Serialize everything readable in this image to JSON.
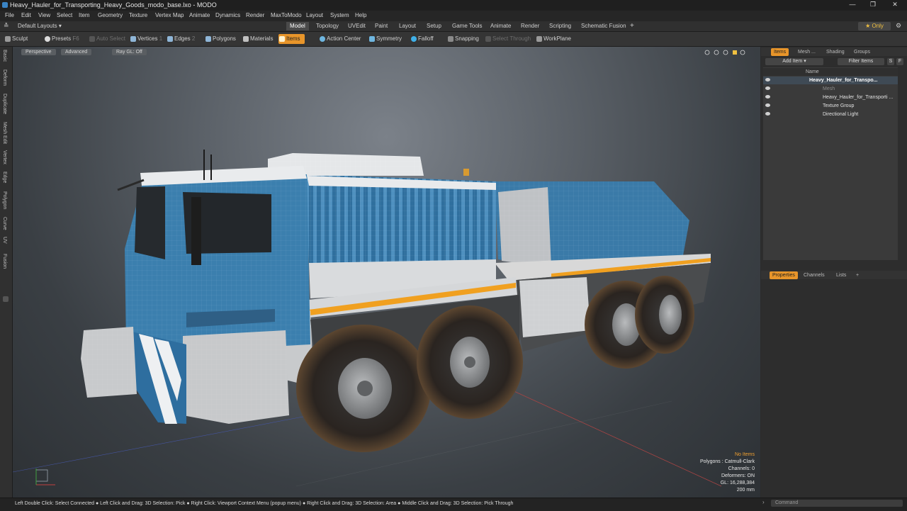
{
  "window": {
    "title": "Heavy_Hauler_for_Transporting_Heavy_Goods_modo_base.lxo - MODO",
    "minimize": "—",
    "maximize": "❐",
    "close": "✕"
  },
  "menu": [
    "File",
    "Edit",
    "View",
    "Select",
    "Item",
    "Geometry",
    "Texture",
    "Vertex Map",
    "Animate",
    "Dynamics",
    "Render",
    "MaxToModo",
    "Layout",
    "System",
    "Help"
  ],
  "layouts": {
    "label": "Default Layouts ▾",
    "tabs": [
      "Model",
      "Topology",
      "UVEdit",
      "Paint",
      "Layout",
      "Setup",
      "Game Tools",
      "Animate",
      "Render",
      "Scripting",
      "Schematic Fusion"
    ],
    "add": "+",
    "only": "★ Only",
    "gear": "⚙"
  },
  "toolbar": {
    "sculpt": "Sculpt",
    "presets": "Presets",
    "presets_key": "F6",
    "auto_select": "Auto Select",
    "vertices": "Vertices",
    "vertices_key": "1",
    "edges": "Edges",
    "edges_key": "2",
    "polygons": "Polygons",
    "materials": "Materials",
    "items": "Items",
    "action_center": "Action Center",
    "symmetry": "Symmetry",
    "falloff": "Falloff",
    "snapping": "Snapping",
    "select_through": "Select Through",
    "workplane": "WorkPlane"
  },
  "left_tabs": [
    "Basic",
    "Deform",
    "Duplicate",
    "Mesh Edit",
    "Vertex",
    "Edge",
    "Polygon",
    "Curve",
    "UV",
    "Fusion"
  ],
  "viewport": {
    "view": "Perspective",
    "shading": "Advanced",
    "raygl": "Ray GL: Off",
    "info_no_items": "No Items",
    "info_polygons": "Polygons : Catmull-Clark",
    "info_channels": "Channels: 0",
    "info_deformers": "Deformers: ON",
    "info_gl": "GL: 16,288,384",
    "info_scale": "200 mm"
  },
  "items_panel": {
    "tabs": [
      "Items",
      "Mesh ...",
      "Shading",
      "Groups"
    ],
    "add_item": "Add Item ▾",
    "filter_items": "Filter Items",
    "s_btn": "S",
    "f_btn": "F",
    "col_name": "Name",
    "rows": [
      {
        "label": "Heavy_Hauler_for_Transpo..."
      },
      {
        "label": "Mesh"
      },
      {
        "label": "Heavy_Hauler_for_Transporti ..."
      },
      {
        "label": "Texture Group"
      },
      {
        "label": "Directional Light"
      }
    ]
  },
  "properties_panel": {
    "tabs": [
      "Properties",
      "Channels",
      "Lists"
    ],
    "add": "+"
  },
  "status": {
    "hint": "Left Double Click: Select Connected ● Left Click and Drag: 3D Selection: Pick ● Right Click: Viewport Context Menu (popup menu) ● Right Click and Drag: 3D Selection: Area ● Middle Click and Drag: 3D Selection: Pick Through",
    "command_placeholder": "Command"
  },
  "colors": {
    "accent": "#e8952a",
    "truck_blue": "#3b7fae",
    "stripe": "#f0a020"
  }
}
